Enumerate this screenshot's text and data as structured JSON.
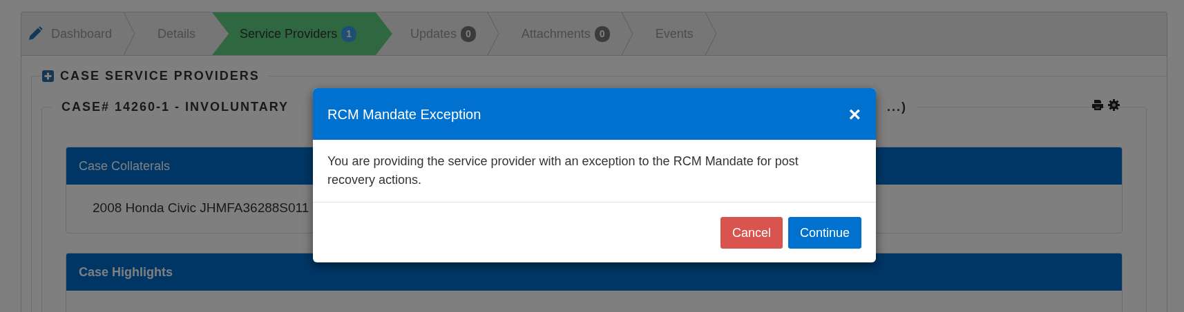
{
  "tabs": [
    {
      "label": "Dashboard",
      "selected": false
    },
    {
      "label": "Details",
      "selected": false
    },
    {
      "label": "Service Providers",
      "badge": "1",
      "selected": true
    },
    {
      "label": "Updates",
      "badge": "0",
      "selected": false
    },
    {
      "label": "Attachments",
      "badge": "0",
      "selected": false
    },
    {
      "label": "Events",
      "selected": false
    }
  ],
  "section": {
    "title": "CASE SERVICE PROVIDERS"
  },
  "case_header": {
    "title": "CASE# 14260-1 - INVOLUNTARY",
    "title_end": "...)"
  },
  "panels": [
    {
      "heading": "Case Collaterals",
      "emphasis": false,
      "lines": [
        "2008 Honda Civic JHMFA36288S011"
      ]
    },
    {
      "heading": "Case Highlights",
      "emphasis": true
    }
  ],
  "modal": {
    "title": "RCM Mandate Exception",
    "close": "×",
    "body": "You are providing the service provider with an exception to the RCM Mandate for post recovery actions.",
    "buttons": [
      {
        "label": "Cancel",
        "kind": "danger"
      },
      {
        "label": "Continue",
        "kind": "primary"
      }
    ]
  }
}
